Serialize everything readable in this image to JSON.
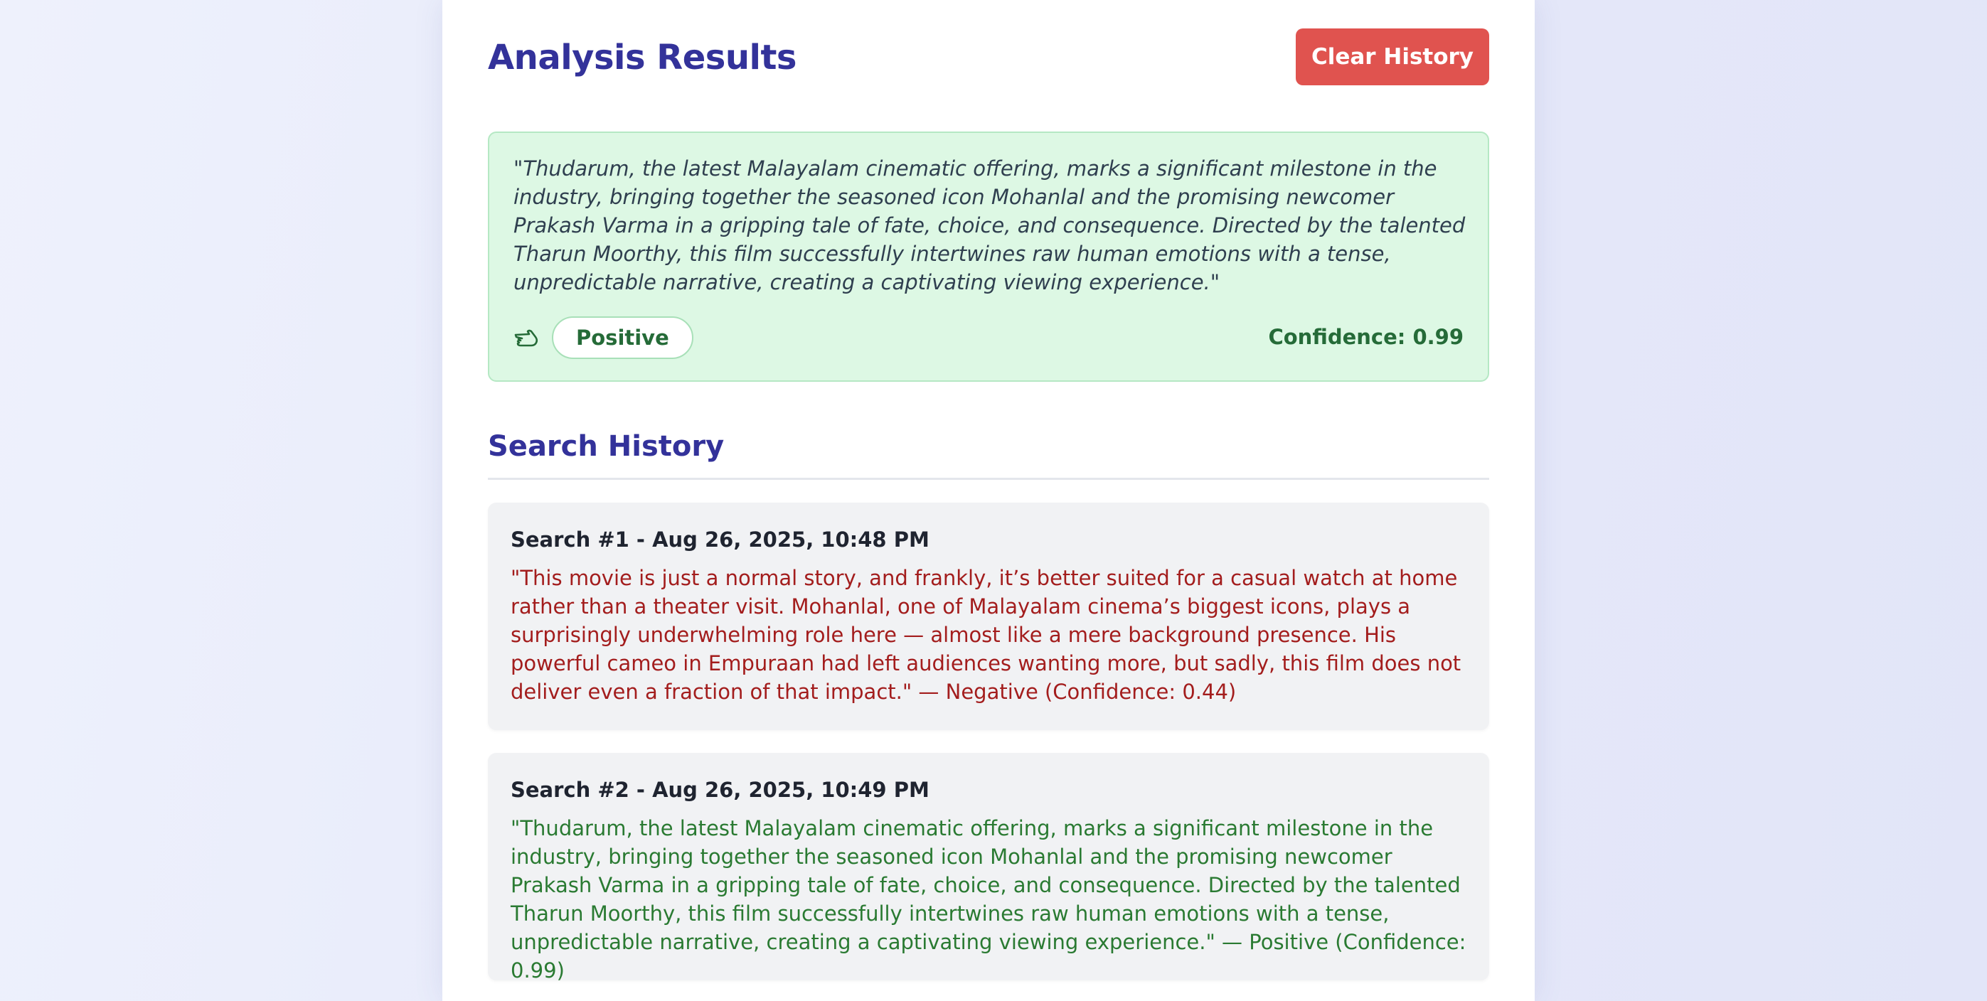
{
  "header": {
    "title": "Analysis Results",
    "clear_label": "Clear History"
  },
  "result": {
    "text": "\"Thudarum, the latest Malayalam cinematic offering, marks a significant milestone in the industry, bringing together the seasoned icon Mohanlal and the promising newcomer Prakash Varma in a gripping tale of fate, choice, and consequence. Directed by the talented Tharun Moorthy, this film successfully intertwines raw human emotions with a tense, unpredictable narrative, creating a captivating viewing experience.\"",
    "sentiment": "Positive",
    "confidence": "Confidence: 0.99",
    "icon": "hand-pointing-icon",
    "colors": {
      "background": "#ddf8e4",
      "accent": "#256b38"
    }
  },
  "history": {
    "title": "Search History",
    "items": [
      {
        "heading": "Search #1 - Aug 26, 2025, 10:48 PM",
        "text": "\"This movie is just a normal story, and frankly, it’s better suited for a casual watch at home rather than a theater visit. Mohanlal, one of Malayalam cinema’s biggest icons, plays a surprisingly underwhelming role here — almost like a mere background presence. His powerful cameo in Empuraan had left audiences wanting more, but sadly, this film does not deliver even a fraction of that impact.\" — Negative (Confidence: 0.44)",
        "sentiment_color": "#a31d1d"
      },
      {
        "heading": "Search #2 - Aug 26, 2025, 10:49 PM",
        "text": "\"Thudarum, the latest Malayalam cinematic offering, marks a significant milestone in the industry, bringing together the seasoned icon Mohanlal and the promising newcomer Prakash Varma in a gripping tale of fate, choice, and consequence. Directed by the talented Tharun Moorthy, this film successfully intertwines raw human emotions with a tense, unpredictable narrative, creating a captivating viewing experience.\" — Positive (Confidence: 0.99)",
        "sentiment_color": "#2a7a32"
      }
    ]
  },
  "colors": {
    "title": "#33329a",
    "clear_button": "#e0534f"
  }
}
